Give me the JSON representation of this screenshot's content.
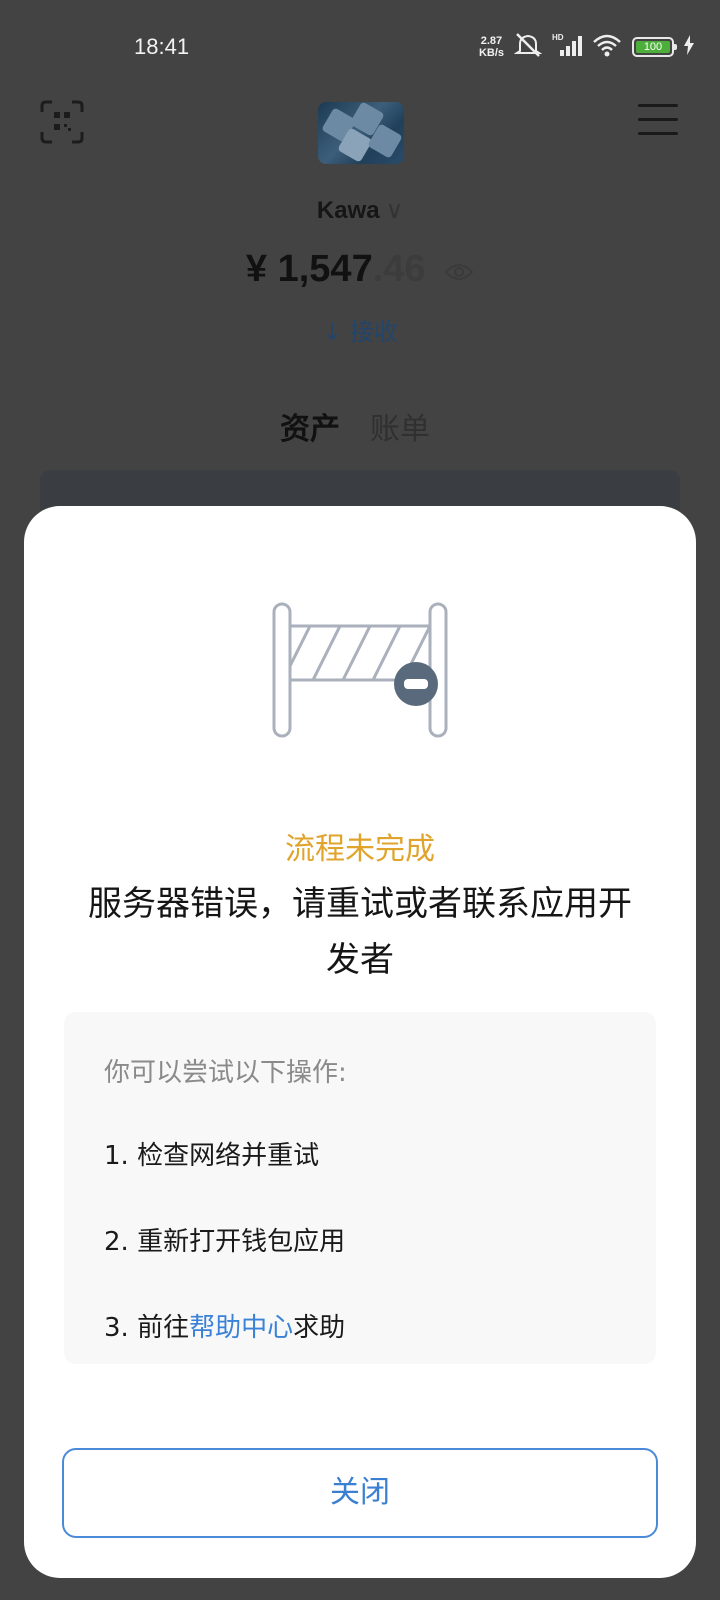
{
  "status_bar": {
    "time": "18:41",
    "net_speed_value": "2.87",
    "net_speed_unit": "KB/s",
    "battery": "100"
  },
  "wallet": {
    "name": "Kawa",
    "balance_currency": "¥",
    "balance_int": "1,547",
    "balance_dec": ".46",
    "receive_label": "↓ 接收",
    "tabs": [
      "资产",
      "账单"
    ]
  },
  "dialog": {
    "title": "流程未完成",
    "message": "服务器错误，请重试或者联系应用开发者",
    "tips_heading": "你可以尝试以下操作:",
    "tips": [
      "1. 检查网络并重试",
      "2. 重新打开钱包应用"
    ],
    "tip3_prefix": "3. 前往",
    "tip3_link": "帮助中心",
    "tip3_suffix": "求助",
    "close_label": "关闭"
  },
  "colors": {
    "overlay": "#434343",
    "title_accent": "#e0a42c",
    "link": "#3a82d6",
    "button_border": "#4a8ad8"
  }
}
